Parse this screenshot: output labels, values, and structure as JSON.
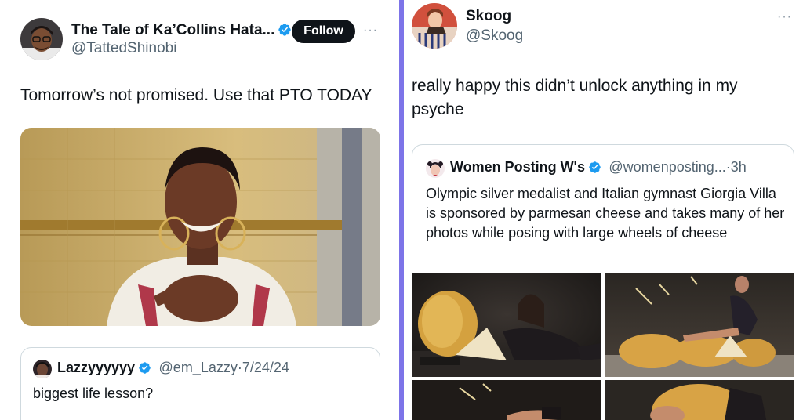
{
  "left_tweet": {
    "author_name": "The Tale of Ka’Collins Hata...",
    "author_handle": "@TattedShinobi",
    "follow_label": "Follow",
    "more_label": "···",
    "text": "Tomorrow’s not promised. Use that PTO TODAY",
    "quote": {
      "author_name": "Lazzyyyyyy",
      "author_handle": "@em_Lazzy",
      "separator": "·",
      "date": "7/24/24",
      "text": "biggest life lesson?"
    }
  },
  "right_tweet": {
    "author_name": "Skoog",
    "author_handle": "@Skoog",
    "more_label": "···",
    "text": "really happy this didn’t unlock anything in my psyche",
    "quote": {
      "author_name": "Women Posting W's",
      "author_handle": "@womenposting...",
      "separator": "·",
      "time": "3h",
      "text": "Olympic silver medalist and Italian gymnast Giorgia Villa is sponsored by parmesan cheese and takes many of her photos while posing with large wheels of cheese"
    }
  },
  "colors": {
    "divider": "#7d74e8",
    "verified_blue": "#1d9bf0",
    "secondary_text": "#536471",
    "border": "#cfd9de"
  },
  "icons": {
    "verified": "verified-badge-icon",
    "more": "more-dots-icon"
  }
}
